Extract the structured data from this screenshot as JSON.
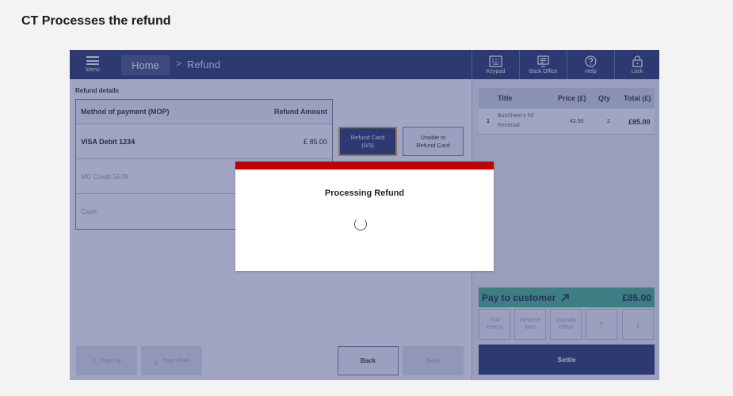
{
  "caption": "CT Processes the refund",
  "topbar": {
    "menu_label": "Menu",
    "home_label": "Home",
    "crumb_separator": ">",
    "crumb_current": "Refund",
    "tools": [
      {
        "label": "Keypad",
        "icon": "keypad-icon"
      },
      {
        "label": "Back Office",
        "icon": "monitor-icon"
      },
      {
        "label": "Help",
        "icon": "help-icon"
      },
      {
        "label": "Lock",
        "icon": "lock-icon"
      }
    ]
  },
  "refund": {
    "section_title": "Refund details",
    "col_method": "Method of payment (MOP)",
    "col_amount": "Refund Amount",
    "rows": [
      {
        "method": "VISA Debit 1234",
        "amount": "£ 85.00"
      },
      {
        "method": "MC Credit 5678",
        "amount": ""
      },
      {
        "method": "Cash",
        "amount": ""
      }
    ],
    "refund_card_label": "Refund Card",
    "refund_card_count": "(0/3)",
    "unable_label_1": "Unable to",
    "unable_label_2": "Refund Card"
  },
  "nav": {
    "page_up": "Page up",
    "page_down": "Page down",
    "back": "Back",
    "next": "Next"
  },
  "basket": {
    "col_title": "Title",
    "col_price": "Price (£)",
    "col_qty": "Qty",
    "col_total": "Total (£)",
    "items": [
      {
        "index": "1",
        "title_1": "BusSheet x 50",
        "title_2": "Reversal",
        "price": "42.50",
        "qty": "2",
        "total": "£85.00"
      }
    ],
    "pay_label": "Pay to customer",
    "pay_amount": "£85.00",
    "actions": {
      "void_1": "Void",
      "void_2": "item(s)",
      "reverse_1": "Reverse",
      "reverse_2": "item",
      "qty_1": "Quantity",
      "qty_2": "editior",
      "up": "↑",
      "down": "↓"
    },
    "settle_label": "Settle"
  },
  "modal": {
    "title": "Processing Refund",
    "accent_color": "#c10000"
  },
  "colors": {
    "primary": "#2e3a6e",
    "pay_green": "#4cb68e",
    "focus_outline": "#e2a64a"
  }
}
